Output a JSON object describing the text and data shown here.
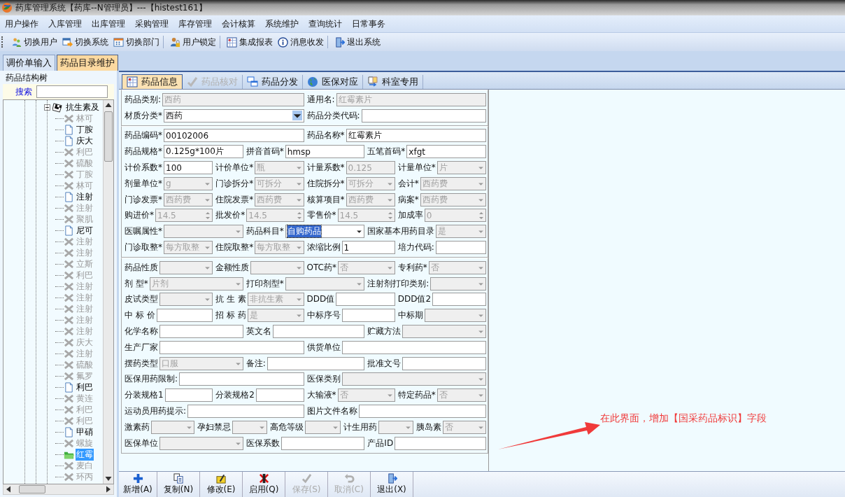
{
  "window": {
    "title": "药库管理系统【药库--N管理员】---【histest161】"
  },
  "menu": [
    "用户操作",
    "入库管理",
    "出库管理",
    "采购管理",
    "库存管理",
    "会计核算",
    "系统维护",
    "查询统计",
    "日常事务"
  ],
  "toolbar": [
    "切换用户",
    "切换系统",
    "切换部门",
    "用户锁定",
    "集成报表",
    "消息收发",
    "退出系统"
  ],
  "doc_tabs": [
    {
      "label": "调价单输入",
      "selected": false
    },
    {
      "label": "药品目录维护",
      "selected": true
    }
  ],
  "tree_panel": {
    "title": "药品结构树",
    "search_label": "搜索",
    "root": {
      "label": "抗生素及",
      "expanded": true,
      "children": [
        {
          "label": "林可",
          "kind": "inactive",
          "selected": false
        },
        {
          "label": "丁胺",
          "kind": "active",
          "selected": false
        },
        {
          "label": "庆大",
          "kind": "active",
          "selected": false
        },
        {
          "label": "利巴",
          "kind": "inactive",
          "selected": false
        },
        {
          "label": "硫酸",
          "kind": "inactive",
          "selected": false
        },
        {
          "label": "丁胺",
          "kind": "inactive",
          "selected": false
        },
        {
          "label": "林可",
          "kind": "inactive",
          "selected": false
        },
        {
          "label": "注射",
          "kind": "active",
          "selected": false
        },
        {
          "label": "注射",
          "kind": "inactive",
          "selected": false
        },
        {
          "label": "聚肌",
          "kind": "inactive",
          "selected": false
        },
        {
          "label": "尼可",
          "kind": "active",
          "selected": false
        },
        {
          "label": "注射",
          "kind": "inactive",
          "selected": false
        },
        {
          "label": "注射",
          "kind": "inactive",
          "selected": false
        },
        {
          "label": "立斯",
          "kind": "inactive",
          "selected": false
        },
        {
          "label": "利巴",
          "kind": "inactive",
          "selected": false
        },
        {
          "label": "注射",
          "kind": "inactive",
          "selected": false
        },
        {
          "label": "注射",
          "kind": "inactive",
          "selected": false
        },
        {
          "label": "注射",
          "kind": "inactive",
          "selected": false
        },
        {
          "label": "注射",
          "kind": "inactive",
          "selected": false
        },
        {
          "label": "注射",
          "kind": "inactive",
          "selected": false
        },
        {
          "label": "庆大",
          "kind": "inactive",
          "selected": false
        },
        {
          "label": "注射",
          "kind": "inactive",
          "selected": false
        },
        {
          "label": "硫酸",
          "kind": "inactive",
          "selected": false
        },
        {
          "label": "氟罗",
          "kind": "inactive",
          "selected": false
        },
        {
          "label": "利巴",
          "kind": "active",
          "selected": false
        },
        {
          "label": "黄连",
          "kind": "inactive",
          "selected": false
        },
        {
          "label": "利巴",
          "kind": "inactive",
          "selected": false
        },
        {
          "label": "利巴",
          "kind": "inactive",
          "selected": false
        },
        {
          "label": "甲硝",
          "kind": "active",
          "selected": false
        },
        {
          "label": "螺旋",
          "kind": "inactive",
          "selected": false
        },
        {
          "label": "红霉",
          "kind": "folder",
          "selected": true
        },
        {
          "label": "麦白",
          "kind": "inactive",
          "selected": false
        },
        {
          "label": "环丙",
          "kind": "inactive",
          "selected": false
        }
      ]
    }
  },
  "inner_tabs": [
    {
      "label": "药品信息",
      "selected": true,
      "disabled": false
    },
    {
      "label": "药品核对",
      "selected": false,
      "disabled": true
    },
    {
      "label": "药品分发",
      "selected": false,
      "disabled": false
    },
    {
      "label": "医保对应",
      "selected": false,
      "disabled": false
    },
    {
      "label": "科室专用",
      "selected": false,
      "disabled": false
    }
  ],
  "form": {
    "sections": [
      {
        "rows": [
          [
            {
              "label": "药品类别:",
              "kind": "text",
              "value": "西药",
              "disabled": true,
              "highlighted": false
            },
            {
              "label": "通用名:",
              "kind": "text",
              "value": "红霉素片",
              "disabled": true,
              "highlighted": false
            }
          ],
          [
            {
              "label": "材质分类*",
              "kind": "combo",
              "value": "西药",
              "disabled": false,
              "highlighted": false
            },
            {
              "label": "药品分类代码:",
              "kind": "text",
              "disabled": false,
              "highlighted": false
            }
          ]
        ]
      },
      {
        "rows": [
          [
            {
              "label": "药品编码*",
              "kind": "text",
              "value": "00102006",
              "disabled": false,
              "highlighted": false
            },
            {
              "label": "药品名称*",
              "kind": "text",
              "value": "红霉素片",
              "disabled": false,
              "highlighted": false
            }
          ],
          [
            {
              "label": "药品规格*",
              "kind": "text",
              "value": "0.125g*100片",
              "disabled": false,
              "highlighted": false
            },
            {
              "label": "拼音首码*",
              "kind": "text",
              "value": "hmsp",
              "disabled": false,
              "highlighted": false
            },
            {
              "label": "五笔首码*",
              "kind": "text",
              "value": "xfgt",
              "disabled": false,
              "highlighted": false
            }
          ],
          [
            {
              "label": "计价系数*",
              "kind": "text",
              "value": "100",
              "disabled": false,
              "highlighted": false
            },
            {
              "label": "计价单位*",
              "kind": "combo",
              "value": "瓶",
              "disabled": true,
              "highlighted": false
            },
            {
              "label": "计量系数*",
              "kind": "text",
              "value": "0.125",
              "disabled": true,
              "highlighted": false
            },
            {
              "label": "计量单位*",
              "kind": "combo",
              "value": "片",
              "disabled": true,
              "highlighted": false
            }
          ],
          [
            {
              "label": "剂量单位*",
              "kind": "combo",
              "value": "g",
              "disabled": true,
              "highlighted": false
            },
            {
              "label": "门诊拆分*",
              "kind": "combo",
              "value": "可拆分",
              "disabled": true,
              "highlighted": false
            },
            {
              "label": "住院拆分*",
              "kind": "combo",
              "value": "可拆分",
              "disabled": true,
              "highlighted": false
            },
            {
              "label": "会计*",
              "kind": "combo",
              "value": "西药费",
              "disabled": true,
              "highlighted": false
            }
          ],
          [
            {
              "label": "门诊发票*",
              "kind": "combo",
              "value": "西药费",
              "disabled": true,
              "highlighted": false
            },
            {
              "label": "住院发票*",
              "kind": "combo",
              "value": "西药费",
              "disabled": true,
              "highlighted": false
            },
            {
              "label": "核算项目*",
              "kind": "combo",
              "value": "西药费",
              "disabled": true,
              "highlighted": false
            },
            {
              "label": "病案*",
              "kind": "combo",
              "value": "西药费",
              "disabled": true,
              "highlighted": false
            }
          ],
          [
            {
              "label": "购进价*",
              "kind": "spin",
              "value": "14.5",
              "disabled": true,
              "highlighted": false
            },
            {
              "label": "批发价*",
              "kind": "spin",
              "value": "14.5",
              "disabled": true,
              "highlighted": false
            },
            {
              "label": "零售价*",
              "kind": "spin",
              "value": "14.5",
              "disabled": true,
              "highlighted": false
            },
            {
              "label": "加成率",
              "kind": "spin",
              "value": "0",
              "disabled": true,
              "highlighted": false
            }
          ],
          [
            {
              "label": "医嘱属性*",
              "kind": "combo",
              "disabled": true,
              "highlighted": false
            },
            {
              "label": "药品科目*",
              "kind": "combo",
              "value": "自购药品",
              "disabled": false,
              "highlighted": true
            },
            {
              "label": "国家基本用药目录",
              "kind": "combo",
              "value": "是",
              "disabled": true,
              "highlighted": false
            }
          ],
          [
            {
              "label": "门诊取整*",
              "kind": "combo",
              "value": "每方取整",
              "disabled": true,
              "highlighted": false
            },
            {
              "label": "住院取整*",
              "kind": "combo",
              "value": "每方取整",
              "disabled": true,
              "highlighted": false
            },
            {
              "label": "浓缩比例",
              "kind": "text",
              "value": "1",
              "disabled": false,
              "highlighted": false
            },
            {
              "label": "培力代码:",
              "kind": "text",
              "disabled": false,
              "highlighted": false
            }
          ]
        ]
      },
      {
        "rows": [
          [
            {
              "label": "药品性质",
              "kind": "combo",
              "disabled": true,
              "highlighted": false
            },
            {
              "label": "金额性质",
              "kind": "combo",
              "disabled": true,
              "highlighted": false
            },
            {
              "label": "OTC药*",
              "kind": "combo",
              "value": "否",
              "disabled": true,
              "highlighted": false
            },
            {
              "label": "专利药*",
              "kind": "combo",
              "value": "否",
              "disabled": true,
              "highlighted": false
            }
          ],
          [
            {
              "label": "剂 型*",
              "kind": "combo",
              "value": "片剂",
              "disabled": true,
              "highlighted": false
            },
            {
              "label": "打印剂型*",
              "kind": "combo",
              "disabled": true,
              "highlighted": false
            },
            {
              "label": "注射剂打印类别:",
              "kind": "combo",
              "disabled": true,
              "highlighted": false
            }
          ],
          [
            {
              "label": "皮试类型",
              "kind": "combo",
              "disabled": true,
              "highlighted": false
            },
            {
              "label": "抗 生 素",
              "kind": "combo",
              "value": "非抗生素",
              "disabled": true,
              "highlighted": false
            },
            {
              "label": "DDD值",
              "kind": "text",
              "disabled": false,
              "highlighted": false
            },
            {
              "label": "DDD值2",
              "kind": "text",
              "disabled": false,
              "highlighted": false
            }
          ],
          [
            {
              "label": "中 标 价",
              "kind": "text",
              "disabled": false,
              "highlighted": false
            },
            {
              "label": "招 标 药",
              "kind": "combo",
              "value": "是",
              "disabled": true,
              "highlighted": false
            },
            {
              "label": "中标序号",
              "kind": "text",
              "disabled": false,
              "highlighted": false
            },
            {
              "label": "中标期",
              "kind": "combo",
              "disabled": true,
              "highlighted": false
            }
          ],
          [
            {
              "label": "化学名称",
              "kind": "text",
              "disabled": false,
              "highlighted": false
            },
            {
              "label": "英文名",
              "kind": "text",
              "disabled": false,
              "highlighted": false
            },
            {
              "label": "贮藏方法",
              "kind": "combo",
              "disabled": true,
              "highlighted": false
            }
          ],
          [
            {
              "label": "生产厂家",
              "kind": "text",
              "disabled": false,
              "highlighted": false
            },
            {
              "label": "供货单位",
              "kind": "text",
              "disabled": false,
              "highlighted": false
            }
          ],
          [
            {
              "label": "摆药类型",
              "kind": "combo",
              "value": "口服",
              "disabled": true,
              "highlighted": false
            },
            {
              "label": "备注:",
              "kind": "text",
              "disabled": false,
              "highlighted": false
            },
            {
              "label": "批准文号",
              "kind": "text",
              "disabled": false,
              "highlighted": false
            }
          ],
          [
            {
              "label": "医保用药限制:",
              "kind": "text",
              "disabled": false,
              "highlighted": false
            },
            {
              "label": "医保类别",
              "kind": "combo",
              "disabled": true,
              "highlighted": false
            }
          ],
          [
            {
              "label": "分装规格1",
              "kind": "text",
              "disabled": false,
              "highlighted": false
            },
            {
              "label": "分装规格2",
              "kind": "text",
              "disabled": false,
              "highlighted": false
            },
            {
              "label": "大输液*",
              "kind": "combo",
              "value": "否",
              "disabled": true,
              "highlighted": false
            },
            {
              "label": "特定药品*",
              "kind": "combo",
              "value": "否",
              "disabled": true,
              "highlighted": false
            }
          ],
          [
            {
              "label": "运动员用药提示:",
              "kind": "text",
              "disabled": false,
              "highlighted": false
            },
            {
              "label": "图片文件名称",
              "kind": "text",
              "disabled": false,
              "highlighted": false
            }
          ],
          [
            {
              "label": "激素药",
              "kind": "combo",
              "disabled": true,
              "highlighted": false
            },
            {
              "label": "孕妇禁忌",
              "kind": "combo",
              "disabled": true,
              "highlighted": false
            },
            {
              "label": "高危等级",
              "kind": "combo",
              "disabled": true,
              "highlighted": false
            },
            {
              "label": "计生用药",
              "kind": "combo",
              "disabled": true,
              "highlighted": false
            },
            {
              "label": "胰岛素",
              "kind": "combo",
              "value": "否",
              "disabled": true,
              "highlighted": false
            }
          ],
          [
            {
              "label": "医保单位",
              "kind": "combo",
              "disabled": true,
              "highlighted": false
            },
            {
              "label": "医保系数",
              "kind": "text",
              "disabled": false,
              "highlighted": false
            },
            {
              "label": "产品ID",
              "kind": "text",
              "disabled": false,
              "highlighted": false
            }
          ]
        ]
      }
    ]
  },
  "annotation": {
    "text": "在此界面，增加【国采药品标识】字段"
  },
  "bottom_buttons": [
    {
      "label": "新增(A)",
      "disabled": false
    },
    {
      "label": "复制(N)",
      "disabled": false
    },
    {
      "label": "修改(E)",
      "disabled": false
    },
    {
      "label": "启用(Q)",
      "disabled": false
    },
    {
      "label": "保存(S)",
      "disabled": true
    },
    {
      "label": "取消(C)",
      "disabled": true
    },
    {
      "label": "退出(X)",
      "disabled": false
    }
  ]
}
